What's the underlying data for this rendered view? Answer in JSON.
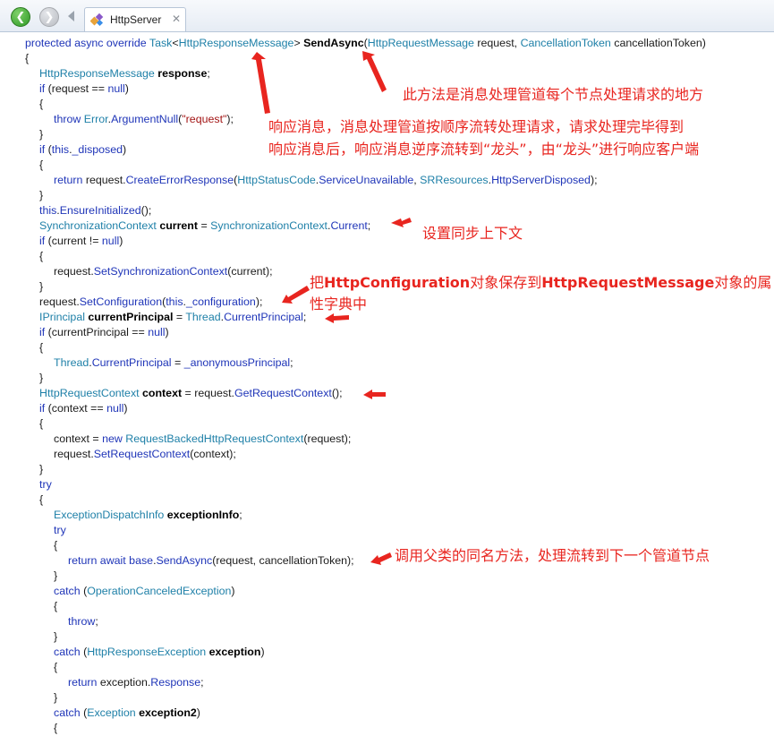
{
  "toolbar": {
    "back_icon": "arrow-left-icon",
    "forward_icon": "arrow-right-icon",
    "tab_title": "HttpServer",
    "tab_close": "✕",
    "accent_green": "#3aa82f"
  },
  "code": {
    "lines": [
      [
        [
          "kw",
          "protected async override "
        ],
        [
          "ty",
          "Task"
        ],
        [
          "pl",
          "<"
        ],
        [
          "ty",
          "HttpResponseMessage"
        ],
        [
          "pl",
          "> "
        ],
        [
          "bd",
          "SendAsync"
        ],
        [
          "pl",
          "("
        ],
        [
          "ty",
          "HttpRequestMessage"
        ],
        [
          "pl",
          " request, "
        ],
        [
          "ty",
          "CancellationToken"
        ],
        [
          "pl",
          " cancellationToken)"
        ]
      ],
      [
        [
          "pl",
          "{"
        ]
      ],
      [
        [
          "ty",
          "HttpResponseMessage "
        ],
        [
          "bd",
          "response"
        ],
        [
          "pl",
          ";"
        ]
      ],
      [
        [
          "kw",
          "if"
        ],
        [
          "pl",
          " (request == "
        ],
        [
          "kw",
          "null"
        ],
        [
          "pl",
          ")"
        ]
      ],
      [
        [
          "pl",
          "{"
        ]
      ],
      [
        [
          "kw",
          "throw "
        ],
        [
          "ty",
          "Error"
        ],
        [
          "pl",
          "."
        ],
        [
          "mb",
          "ArgumentNull"
        ],
        [
          "pl",
          "("
        ],
        [
          "st",
          "\"request\""
        ],
        [
          "pl",
          ");"
        ]
      ],
      [
        [
          "pl",
          "}"
        ]
      ],
      [
        [
          "kw",
          "if"
        ],
        [
          "pl",
          " ("
        ],
        [
          "kw",
          "this"
        ],
        [
          "pl",
          "."
        ],
        [
          "mb",
          "_disposed"
        ],
        [
          "pl",
          ")"
        ]
      ],
      [
        [
          "pl",
          "{"
        ]
      ],
      [
        [
          "kw",
          "return "
        ],
        [
          "pl",
          "request."
        ],
        [
          "mb",
          "CreateErrorResponse"
        ],
        [
          "pl",
          "("
        ],
        [
          "ty",
          "HttpStatusCode"
        ],
        [
          "pl",
          "."
        ],
        [
          "mb",
          "ServiceUnavailable"
        ],
        [
          "pl",
          ", "
        ],
        [
          "ty",
          "SRResources"
        ],
        [
          "pl",
          "."
        ],
        [
          "mb",
          "HttpServerDisposed"
        ],
        [
          "pl",
          ");"
        ]
      ],
      [
        [
          "pl",
          "}"
        ]
      ],
      [
        [
          "kw",
          "this"
        ],
        [
          "pl",
          "."
        ],
        [
          "mb",
          "EnsureInitialized"
        ],
        [
          "pl",
          "();"
        ]
      ],
      [
        [
          "ty",
          "SynchronizationContext "
        ],
        [
          "bd",
          "current"
        ],
        [
          "pl",
          " = "
        ],
        [
          "ty",
          "SynchronizationContext"
        ],
        [
          "pl",
          "."
        ],
        [
          "mb",
          "Current"
        ],
        [
          "pl",
          ";"
        ]
      ],
      [
        [
          "kw",
          "if"
        ],
        [
          "pl",
          " (current != "
        ],
        [
          "kw",
          "null"
        ],
        [
          "pl",
          ")"
        ]
      ],
      [
        [
          "pl",
          "{"
        ]
      ],
      [
        [
          "pl",
          "request."
        ],
        [
          "mb",
          "SetSynchronizationContext"
        ],
        [
          "pl",
          "(current);"
        ]
      ],
      [
        [
          "pl",
          "}"
        ]
      ],
      [
        [
          "pl",
          "request."
        ],
        [
          "mb",
          "SetConfiguration"
        ],
        [
          "pl",
          "("
        ],
        [
          "kw",
          "this"
        ],
        [
          "pl",
          "."
        ],
        [
          "mb",
          "_configuration"
        ],
        [
          "pl",
          ");"
        ]
      ],
      [
        [
          "ty",
          "IPrincipal "
        ],
        [
          "bd",
          "currentPrincipal"
        ],
        [
          "pl",
          " = "
        ],
        [
          "ty",
          "Thread"
        ],
        [
          "pl",
          "."
        ],
        [
          "mb",
          "CurrentPrincipal"
        ],
        [
          "pl",
          ";"
        ]
      ],
      [
        [
          "kw",
          "if"
        ],
        [
          "pl",
          " (currentPrincipal == "
        ],
        [
          "kw",
          "null"
        ],
        [
          "pl",
          ")"
        ]
      ],
      [
        [
          "pl",
          "{"
        ]
      ],
      [
        [
          "ty",
          "Thread"
        ],
        [
          "pl",
          "."
        ],
        [
          "mb",
          "CurrentPrincipal"
        ],
        [
          "pl",
          " = "
        ],
        [
          "mb",
          "_anonymousPrincipal"
        ],
        [
          "pl",
          ";"
        ]
      ],
      [
        [
          "pl",
          "}"
        ]
      ],
      [
        [
          "ty",
          "HttpRequestContext "
        ],
        [
          "bd",
          "context"
        ],
        [
          "pl",
          " = request."
        ],
        [
          "mb",
          "GetRequestContext"
        ],
        [
          "pl",
          "();"
        ]
      ],
      [
        [
          "kw",
          "if"
        ],
        [
          "pl",
          " (context == "
        ],
        [
          "kw",
          "null"
        ],
        [
          "pl",
          ")"
        ]
      ],
      [
        [
          "pl",
          "{"
        ]
      ],
      [
        [
          "pl",
          "context = "
        ],
        [
          "kw",
          "new "
        ],
        [
          "ty",
          "RequestBackedHttpRequestContext"
        ],
        [
          "pl",
          "(request);"
        ]
      ],
      [
        [
          "pl",
          "request."
        ],
        [
          "mb",
          "SetRequestContext"
        ],
        [
          "pl",
          "(context);"
        ]
      ],
      [
        [
          "pl",
          "}"
        ]
      ],
      [
        [
          "kw",
          "try"
        ]
      ],
      [
        [
          "pl",
          "{"
        ]
      ],
      [
        [
          "ty",
          "ExceptionDispatchInfo "
        ],
        [
          "bd",
          "exceptionInfo"
        ],
        [
          "pl",
          ";"
        ]
      ],
      [
        [
          "kw",
          "try"
        ]
      ],
      [
        [
          "pl",
          "{"
        ]
      ],
      [
        [
          "kw",
          "return await base"
        ],
        [
          "pl",
          "."
        ],
        [
          "mb",
          "SendAsync"
        ],
        [
          "pl",
          "(request, cancellationToken);"
        ]
      ],
      [
        [
          "pl",
          "}"
        ]
      ],
      [
        [
          "kw",
          "catch"
        ],
        [
          "pl",
          " ("
        ],
        [
          "ty",
          "OperationCanceledException"
        ],
        [
          "pl",
          ")"
        ]
      ],
      [
        [
          "pl",
          "{"
        ]
      ],
      [
        [
          "kw",
          "throw"
        ],
        [
          "pl",
          ";"
        ]
      ],
      [
        [
          "pl",
          "}"
        ]
      ],
      [
        [
          "kw",
          "catch"
        ],
        [
          "pl",
          " ("
        ],
        [
          "ty",
          "HttpResponseException "
        ],
        [
          "bd",
          "exception"
        ],
        [
          "pl",
          ")"
        ]
      ],
      [
        [
          "pl",
          "{"
        ]
      ],
      [
        [
          "kw",
          "return "
        ],
        [
          "pl",
          "exception."
        ],
        [
          "mb",
          "Response"
        ],
        [
          "pl",
          ";"
        ]
      ],
      [
        [
          "pl",
          "}"
        ]
      ],
      [
        [
          "kw",
          "catch"
        ],
        [
          "pl",
          " ("
        ],
        [
          "ty",
          "Exception "
        ],
        [
          "bd",
          "exception2"
        ],
        [
          "pl",
          ")"
        ]
      ],
      [
        [
          "pl",
          "{"
        ]
      ]
    ],
    "indent": [
      0,
      0,
      1,
      1,
      1,
      2,
      1,
      1,
      1,
      2,
      1,
      1,
      1,
      1,
      1,
      2,
      1,
      1,
      1,
      1,
      1,
      2,
      1,
      1,
      1,
      1,
      2,
      2,
      1,
      1,
      1,
      2,
      2,
      2,
      3,
      2,
      2,
      2,
      3,
      2,
      2,
      2,
      3,
      2,
      2,
      2
    ]
  },
  "annotations": {
    "sendasync_note": "此方法是消息处理管道每个节点处理请求的地方",
    "response_note_1": "响应消息，消息处理管道按顺序流转处理请求，请求处理完毕得到",
    "response_note_2": "响应消息后，响应消息逆序流转到“龙头”，由“龙头”进行响应客户端",
    "sync_note": "设置同步上下文",
    "config_note_prefix": "把",
    "config_note_cls1": "HttpConfiguration",
    "config_note_mid": "对象保存到",
    "config_note_cls2": "HttpRequestMessage",
    "config_note_suffix": "对象的属",
    "config_note_2": "性字典中",
    "base_note": "调用父类的同名方法，处理流转到下一个管道节点",
    "annotation_color": "#e8251f"
  }
}
